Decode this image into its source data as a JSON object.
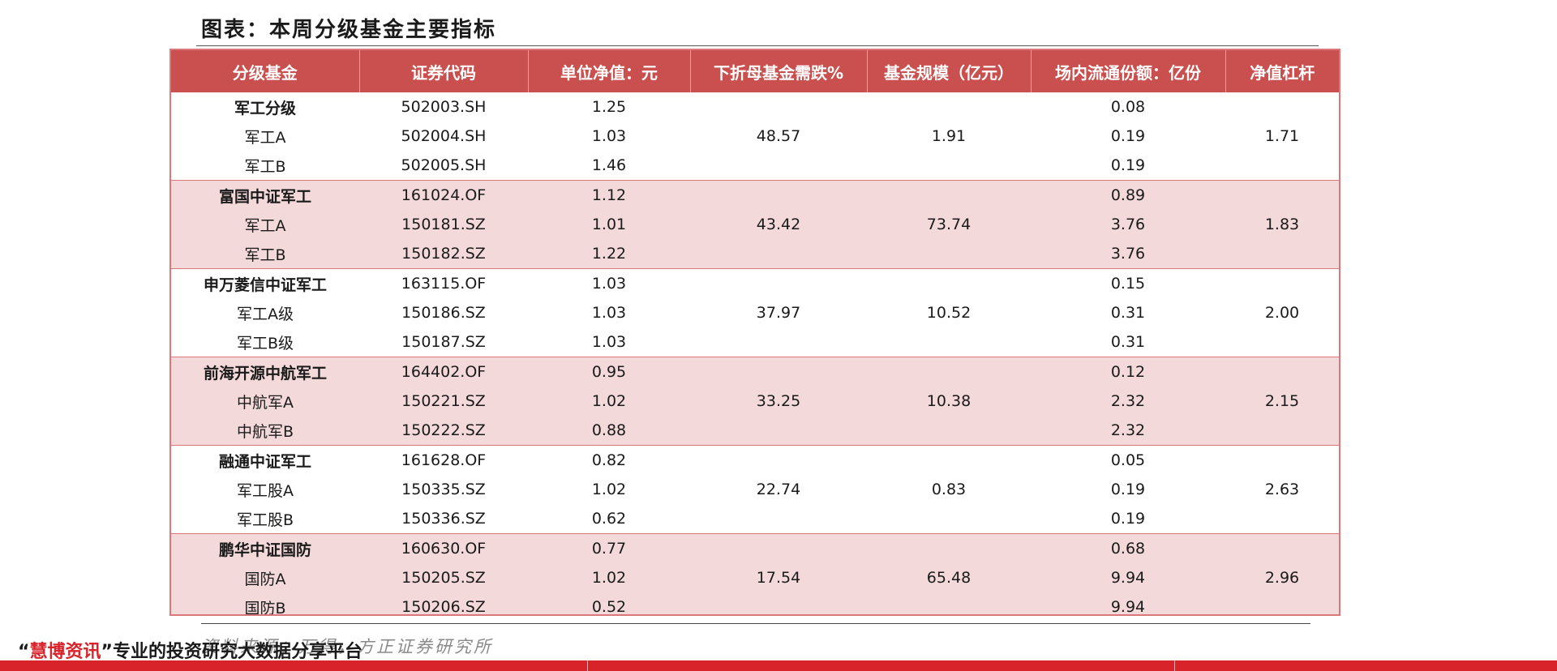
{
  "title": "图表：本周分级基金主要指标",
  "table": {
    "headers": [
      "分级基金",
      "证券代码",
      "单位净值：元",
      "下折母基金需跌%",
      "基金规模（亿元）",
      "场内流通份额：亿份",
      "净值杠杆"
    ],
    "groups": [
      {
        "drop_pct": "48.57",
        "scale": "1.91",
        "leverage": "1.71",
        "rows": [
          {
            "name": "军工分级",
            "code": "502003.SH",
            "nav": "1.25",
            "shares": "0.08"
          },
          {
            "name": "军工A",
            "code": "502004.SH",
            "nav": "1.03",
            "shares": "0.19"
          },
          {
            "name": "军工B",
            "code": "502005.SH",
            "nav": "1.46",
            "shares": "0.19"
          }
        ]
      },
      {
        "drop_pct": "43.42",
        "scale": "73.74",
        "leverage": "1.83",
        "rows": [
          {
            "name": "富国中证军工",
            "code": "161024.OF",
            "nav": "1.12",
            "shares": "0.89"
          },
          {
            "name": "军工A",
            "code": "150181.SZ",
            "nav": "1.01",
            "shares": "3.76"
          },
          {
            "name": "军工B",
            "code": "150182.SZ",
            "nav": "1.22",
            "shares": "3.76"
          }
        ]
      },
      {
        "drop_pct": "37.97",
        "scale": "10.52",
        "leverage": "2.00",
        "rows": [
          {
            "name": "申万菱信中证军工",
            "code": "163115.OF",
            "nav": "1.03",
            "shares": "0.15"
          },
          {
            "name": "军工A级",
            "code": "150186.SZ",
            "nav": "1.03",
            "shares": "0.31"
          },
          {
            "name": "军工B级",
            "code": "150187.SZ",
            "nav": "1.03",
            "shares": "0.31"
          }
        ]
      },
      {
        "drop_pct": "33.25",
        "scale": "10.38",
        "leverage": "2.15",
        "rows": [
          {
            "name": "前海开源中航军工",
            "code": "164402.OF",
            "nav": "0.95",
            "shares": "0.12"
          },
          {
            "name": "中航军A",
            "code": "150221.SZ",
            "nav": "1.02",
            "shares": "2.32"
          },
          {
            "name": "中航军B",
            "code": "150222.SZ",
            "nav": "0.88",
            "shares": "2.32"
          }
        ]
      },
      {
        "drop_pct": "22.74",
        "scale": "0.83",
        "leverage": "2.63",
        "rows": [
          {
            "name": "融通中证军工",
            "code": "161628.OF",
            "nav": "0.82",
            "shares": "0.05"
          },
          {
            "name": "军工股A",
            "code": "150335.SZ",
            "nav": "1.02",
            "shares": "0.19"
          },
          {
            "name": "军工股B",
            "code": "150336.SZ",
            "nav": "0.62",
            "shares": "0.19"
          }
        ]
      },
      {
        "drop_pct": "17.54",
        "scale": "65.48",
        "leverage": "2.96",
        "rows": [
          {
            "name": "鹏华中证国防",
            "code": "160630.OF",
            "nav": "0.77",
            "shares": "0.68"
          },
          {
            "name": "国防A",
            "code": "150205.SZ",
            "nav": "1.02",
            "shares": "9.94"
          },
          {
            "name": "国防B",
            "code": "150206.SZ",
            "nav": "0.52",
            "shares": "9.94"
          }
        ]
      }
    ]
  },
  "source": "资料来源：万得，方正证券研究所",
  "watermark": {
    "open_quote": "“",
    "brand": "慧博资讯",
    "close_quote": "”",
    "tagline": "专业的投资研究大数据分享平台"
  },
  "colors": {
    "header_bg": "#c9504e",
    "alt_row_bg": "#f3d9da",
    "border": "#d9777a",
    "brand_red": "#d8232a"
  }
}
